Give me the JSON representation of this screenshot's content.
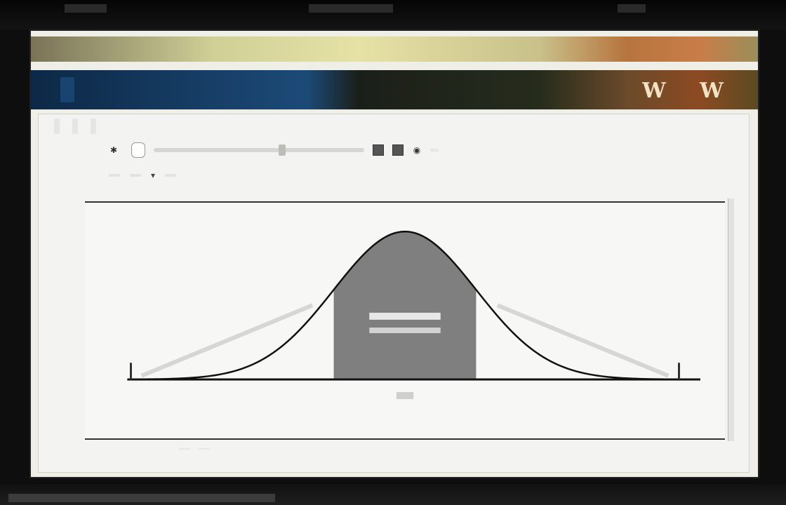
{
  "window": {
    "title": "",
    "badges": [
      "W",
      "W"
    ]
  },
  "menu": {
    "items": [
      "",
      "",
      ""
    ]
  },
  "toolbar": {
    "items": [
      "",
      ""
    ]
  },
  "row2": {
    "fields": [
      "",
      "",
      ""
    ]
  },
  "status": {
    "items": [
      "",
      ""
    ]
  },
  "colors": {
    "title_text": "#7fc6ec",
    "chart_fill": "#7f7f7f",
    "chart_line": "#111111"
  },
  "icons": {
    "toolbar_leading": "pin-icon",
    "dropdown": "chevron-down-icon"
  },
  "chart_data": {
    "type": "area",
    "title": "",
    "xlabel": "",
    "ylabel": "",
    "x": [
      -4,
      -3.5,
      -3,
      -2.5,
      -2,
      -1.5,
      -1,
      -0.5,
      0,
      0.5,
      1,
      1.5,
      2,
      2.5,
      3,
      3.5,
      4
    ],
    "values": [
      0.0001,
      0.0009,
      0.0044,
      0.0175,
      0.054,
      0.1295,
      0.242,
      0.3521,
      0.399,
      0.3521,
      0.242,
      0.1295,
      0.054,
      0.0175,
      0.0044,
      0.0009,
      0.0001
    ],
    "shaded_region": [
      -1,
      1
    ],
    "xlim": [
      -4.2,
      4.2
    ],
    "ylim": [
      0,
      0.42
    ],
    "grid": false,
    "tick_labels": [],
    "annotation": ""
  }
}
